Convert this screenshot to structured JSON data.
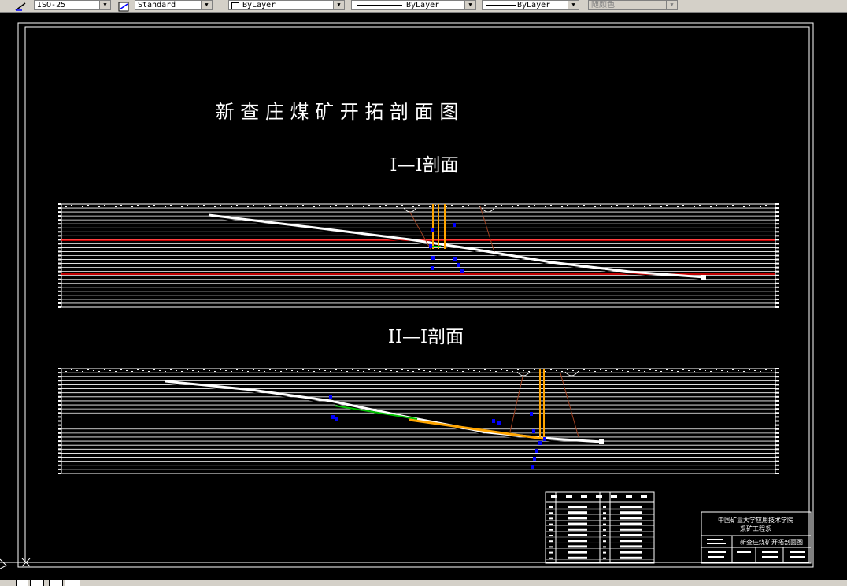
{
  "toolbar": {
    "dimstyle": "ISO-25",
    "tablestyle": "Standard",
    "layer": "ByLayer",
    "linetype": "ByLayer",
    "lineweight": "ByLayer",
    "plotstyle": "随颜色"
  },
  "drawing": {
    "main_title": "新 查 庄 煤 矿 开 拓 剖 面 图",
    "section1_title": "I—I剖面",
    "section2_title": "II—I剖面",
    "title_block": {
      "institution": "中国矿业大学应用技术学院",
      "department": "采矿工程系",
      "drawing_name": "新查庄煤矿开拓剖面图"
    }
  },
  "colors": {
    "background": "#000000",
    "border": "#ffffff",
    "coal_seam": "#ff0000",
    "shaft": "#ffa500",
    "borehole": "#0000ff",
    "roadway": "#00c000",
    "slope": "#a04020"
  }
}
